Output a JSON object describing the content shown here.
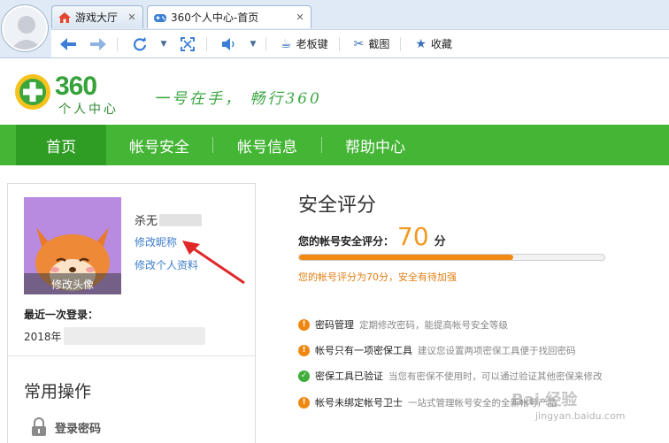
{
  "browser": {
    "tabs": [
      {
        "label": "游戏大厅",
        "close": "✕"
      },
      {
        "label": "360个人中心-首页",
        "close": "✕"
      }
    ],
    "toolbar": {
      "boss_key": "老板键",
      "screenshot": "截图",
      "favorites": "收藏"
    }
  },
  "site": {
    "logo_number": "360",
    "logo_sub": "个人中心",
    "slogan": "一号在手， 畅行360"
  },
  "nav": {
    "items": [
      "首页",
      "帐号安全",
      "帐号信息",
      "帮助中心"
    ]
  },
  "profile": {
    "edit_avatar": "修改头像",
    "nickname_prefix": "杀无",
    "edit_nickname": "修改昵称",
    "edit_profile": "修改个人资料",
    "last_login_label": "最近一次登录：",
    "last_login_prefix": "2018年"
  },
  "common": {
    "title": "常用操作",
    "login_password": "登录密码"
  },
  "security": {
    "title": "安全评分",
    "score_label": "您的帐号安全评分：",
    "score": "70",
    "score_unit": "分",
    "score_fraction": 0.7,
    "note": "您的帐号评分为70分，安全有待加强",
    "items": [
      {
        "status": "warn",
        "name": "密码管理",
        "desc": "定期修改密码，能提高帐号安全等级"
      },
      {
        "status": "warn",
        "name": "帐号只有一项密保工具",
        "desc": "建议您设置两项密保工具便于找回密码"
      },
      {
        "status": "ok",
        "name": "密保工具已验证",
        "desc": "当您有密保不使用时，可以通过验证其他密保来修改"
      },
      {
        "status": "warn",
        "name": "帐号未绑定帐号卫士",
        "desc": "一站式管理帐号安全的全新帐号产品"
      }
    ]
  },
  "watermark": {
    "text": "Bai 经验",
    "url": "jingyan.baidu.com"
  },
  "colors": {
    "nav_green": "#45b535",
    "nav_active": "#2f9c24",
    "score_orange": "#f39a22",
    "link_blue": "#3e7fc9"
  }
}
